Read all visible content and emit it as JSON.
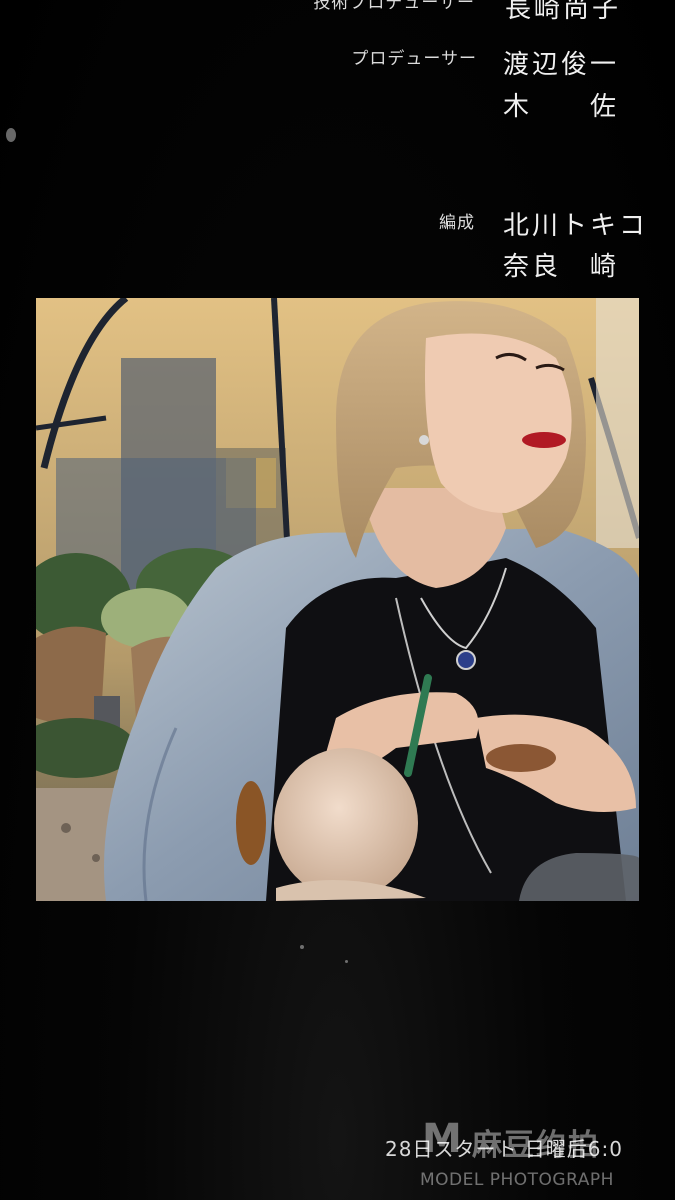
{
  "credits": {
    "top_partial": {
      "role": "技術プロデューサー",
      "name": "長崎尚子"
    },
    "producer": {
      "role": "プロデューサー",
      "names": [
        "渡辺俊一",
        "木　　佐"
      ]
    },
    "composition": {
      "role": "編成",
      "names": [
        "北川トキコ",
        "奈良　崎"
      ]
    }
  },
  "caption": "28日スタート 日曜后6:0",
  "watermark": {
    "logo": "M",
    "brand_cn": "麻豆约拍",
    "brand_en": "MODEL PHOTOGRAPH"
  },
  "colors": {
    "background": "#000000",
    "credit_text": "#f0f0f0",
    "photo_sky": "#d9b77a"
  }
}
